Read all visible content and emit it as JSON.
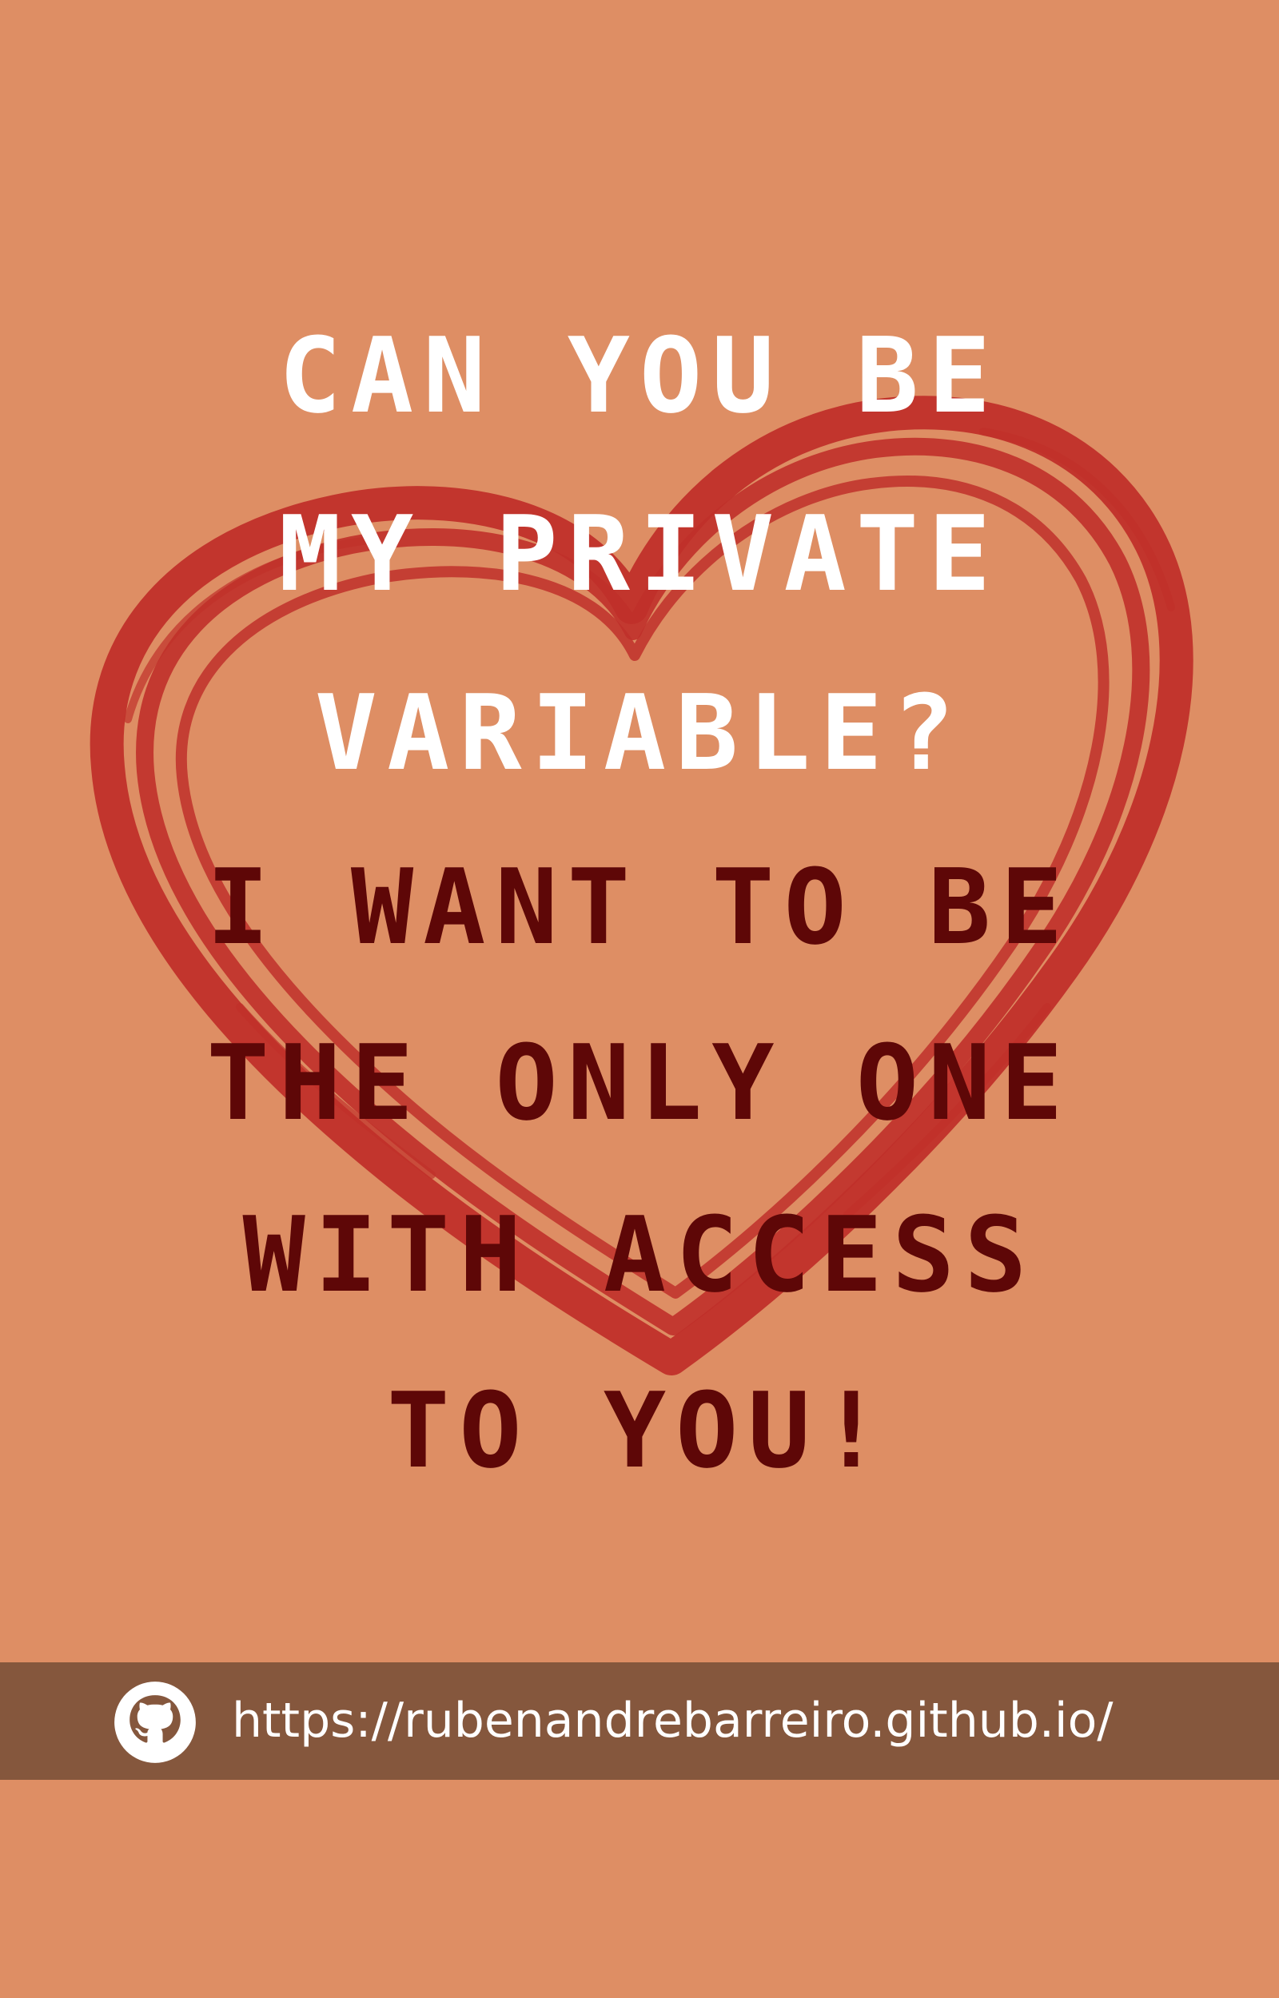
{
  "colors": {
    "background": "#DE8E64",
    "heart": "#C0302A",
    "question_text": "#FFFFFF",
    "answer_text": "#5E0707",
    "footer_bar": "#85573D"
  },
  "question": {
    "lines": [
      "Can you be",
      "my private",
      "variable?"
    ]
  },
  "answer": {
    "lines": [
      "I want to be",
      "the only one",
      "with access",
      "to you!"
    ]
  },
  "footer": {
    "icon": "github-icon",
    "url": "https://rubenandrebarreiro.github.io/"
  }
}
